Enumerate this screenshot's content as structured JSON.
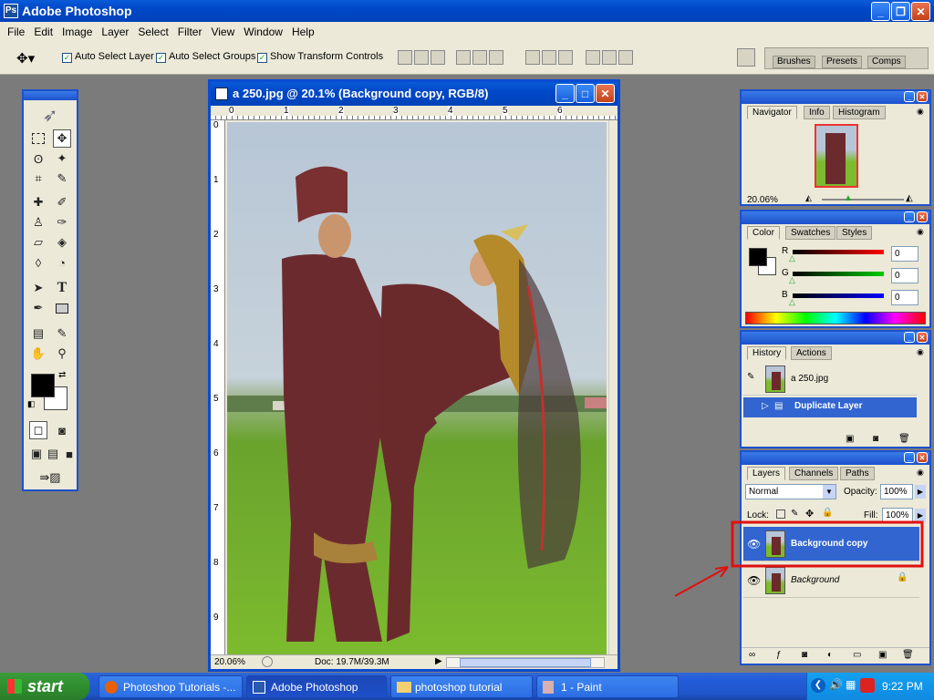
{
  "app": {
    "title": "Adobe Photoshop"
  },
  "menu": [
    "File",
    "Edit",
    "Image",
    "Layer",
    "Select",
    "Filter",
    "View",
    "Window",
    "Help"
  ],
  "options": {
    "auto_select_layer": "Auto Select Layer",
    "auto_select_groups": "Auto Select Groups",
    "show_transform": "Show Transform Controls"
  },
  "well": {
    "tabs": [
      "Brushes",
      "Presets",
      "Comps"
    ]
  },
  "document": {
    "title": "a 250.jpg @ 20.1% (Background copy, RGB/8)",
    "zoom": "20.06%",
    "doc_info": "Doc: 19.7M/39.3M",
    "ruler_h": [
      "0",
      "1",
      "2",
      "3",
      "4",
      "5",
      "6"
    ],
    "ruler_v": [
      "0",
      "1",
      "2",
      "3",
      "4",
      "5",
      "6",
      "7",
      "8",
      "9"
    ]
  },
  "navigator": {
    "tabs": [
      "Navigator",
      "Info",
      "Histogram"
    ],
    "zoom": "20.06%"
  },
  "color": {
    "tabs": [
      "Color",
      "Swatches",
      "Styles"
    ],
    "r_label": "R",
    "g_label": "G",
    "b_label": "B",
    "r": "0",
    "g": "0",
    "b": "0"
  },
  "history": {
    "tabs": [
      "History",
      "Actions"
    ],
    "snapshot": "a 250.jpg",
    "step": "Duplicate Layer"
  },
  "layers": {
    "tabs": [
      "Layers",
      "Channels",
      "Paths"
    ],
    "blend_mode": "Normal",
    "opacity_label": "Opacity:",
    "opacity": "100%",
    "lock_label": "Lock:",
    "fill_label": "Fill:",
    "fill": "100%",
    "items": [
      {
        "name": "Background copy"
      },
      {
        "name": "Background"
      }
    ]
  },
  "taskbar": {
    "start": "start",
    "items": [
      "Photoshop Tutorials -...",
      "Adobe Photoshop",
      "photoshop tutorial",
      "1 - Paint"
    ],
    "clock": "9:22 PM"
  },
  "colors": {
    "accent": "#1c52cc",
    "highlight": "#3265d0",
    "annotation": "#e01010"
  }
}
